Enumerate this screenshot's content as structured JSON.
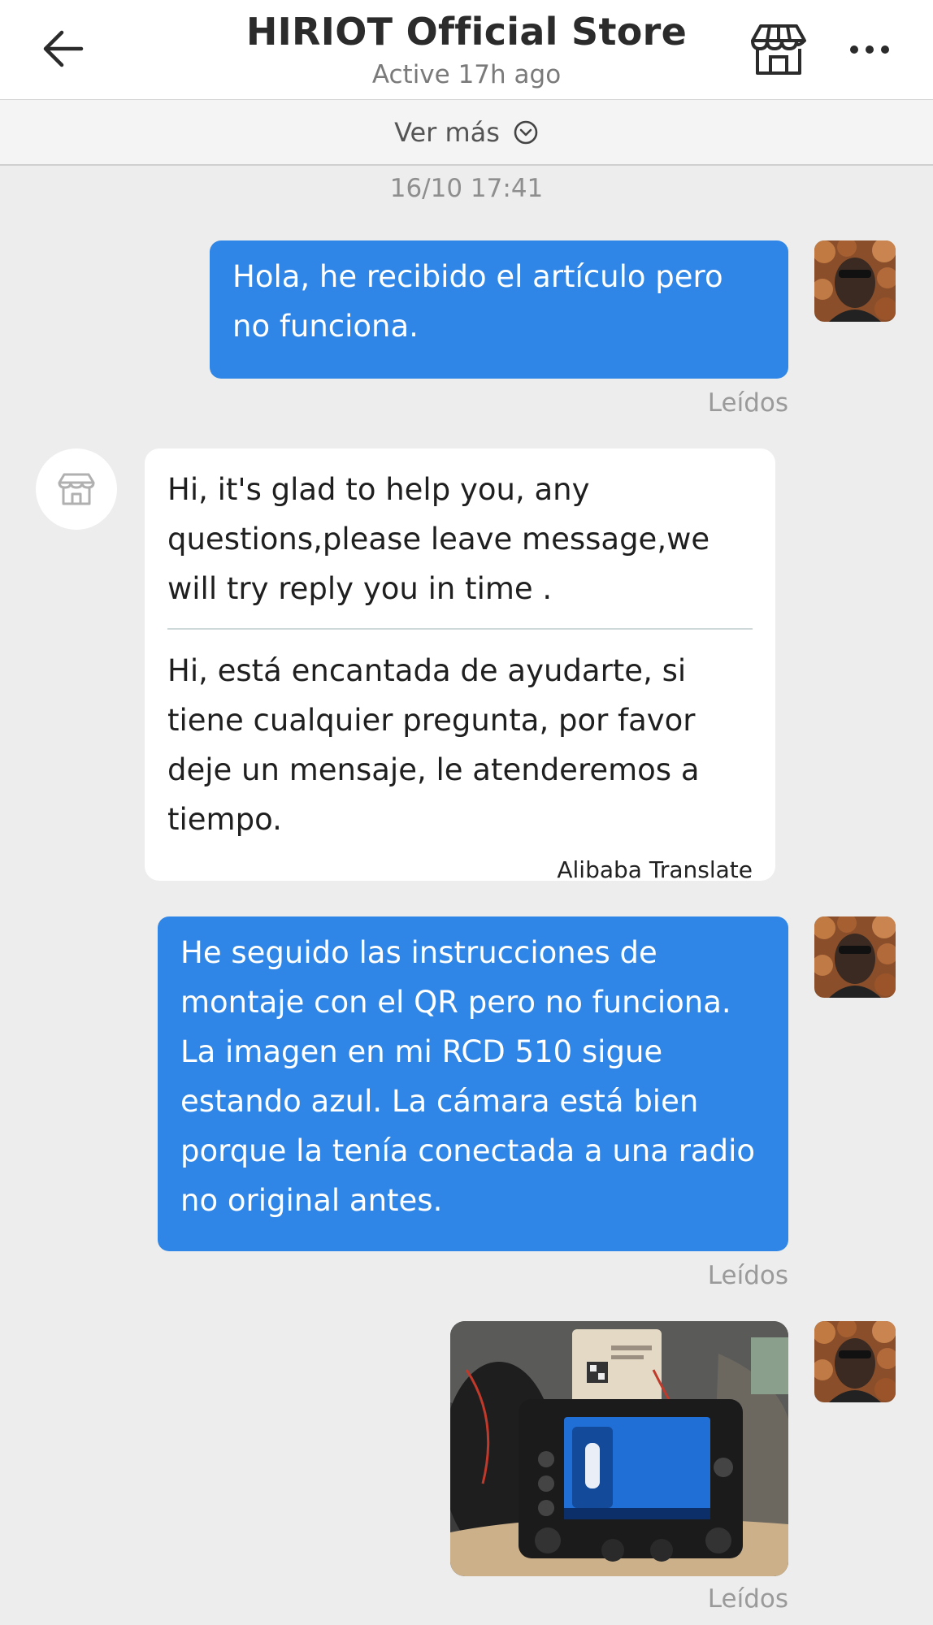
{
  "header": {
    "title": "HIRIOT Official Store",
    "status": "Active 17h ago",
    "back_icon": "arrow-left-icon",
    "store_icon": "storefront-icon",
    "more_icon": "more-dots-icon"
  },
  "history": {
    "label": "Ver más",
    "icon": "chevron-down-circle-icon"
  },
  "timestamp": "16/10 17:41",
  "messages": [
    {
      "from": "user",
      "text": "Hola, he recibido el artículo pero no funciona.",
      "status": "Leídos"
    },
    {
      "from": "store",
      "original": "Hi, it's glad to help you, any questions,please leave message,we will try reply you in time .",
      "translated": "Hi, está encantada de ayudarte, si tiene cualquier pregunta, por favor deje un mensaje, le atenderemos a tiempo.",
      "translate_note": "Alibaba Translate"
    },
    {
      "from": "user",
      "text": "He seguido las instrucciones de montaje con el QR pero no funciona. La imagen en mi RCD 510 sigue estando azul. La cámara está bien porque la tenía conectada a una radio no original antes.",
      "status": "Leídos"
    },
    {
      "from": "user",
      "type": "image",
      "status": "Leídos"
    }
  ],
  "colors": {
    "outgoing_bubble": "#2f86e6",
    "background": "#ededed"
  }
}
